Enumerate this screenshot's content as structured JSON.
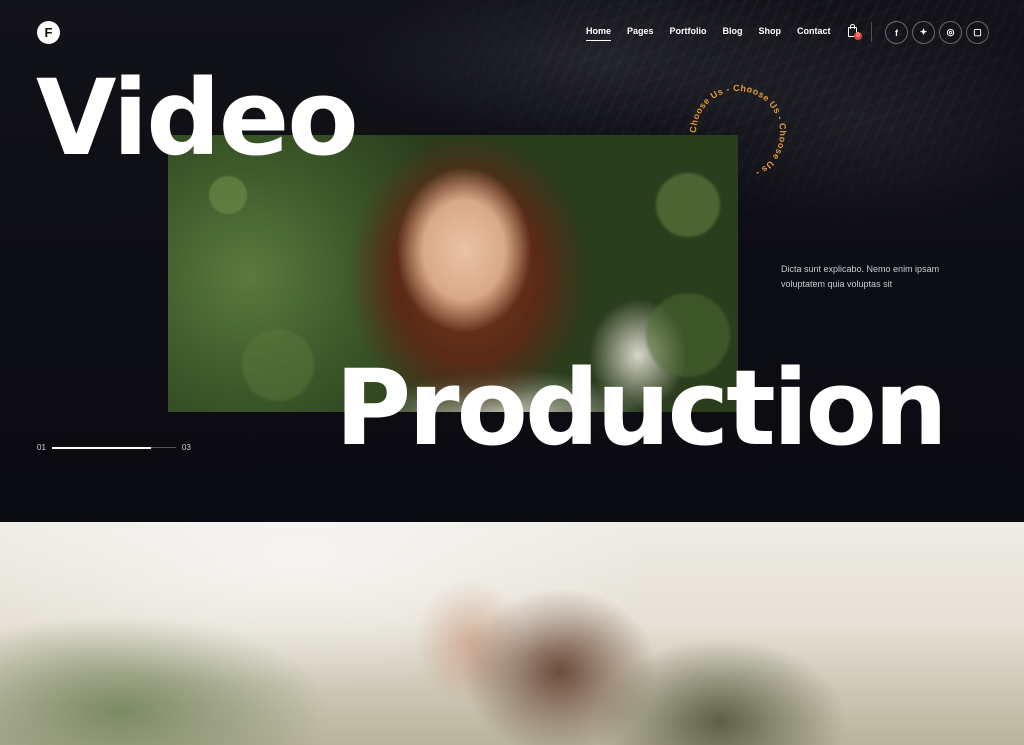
{
  "header": {
    "logo_letter": "F",
    "nav": [
      {
        "label": "Home",
        "active": true
      },
      {
        "label": "Pages",
        "active": false
      },
      {
        "label": "Portfolio",
        "active": false
      },
      {
        "label": "Blog",
        "active": false
      },
      {
        "label": "Shop",
        "active": false
      },
      {
        "label": "Contact",
        "active": false
      }
    ],
    "cart_count": "0",
    "social": [
      {
        "icon": "facebook-icon",
        "glyph": "f"
      },
      {
        "icon": "twitter-icon",
        "glyph": "✦"
      },
      {
        "icon": "dribbble-icon",
        "glyph": "◎"
      },
      {
        "icon": "instagram-icon",
        "glyph": "▢"
      }
    ]
  },
  "hero": {
    "headline_line1": "Video",
    "headline_line2": "Production",
    "circle_text": "Choose Us - Choose Us - Choose Us - ",
    "tagline": "Dicta sunt explicabo. Nemo enim ipsam voluptatem quia voluptas sit",
    "slider_start": "01",
    "slider_end": "03",
    "slider_progress": 0.8
  },
  "colors": {
    "background": "#0d0e14",
    "accent": "#e49a3a",
    "badge": "#e0443a"
  }
}
